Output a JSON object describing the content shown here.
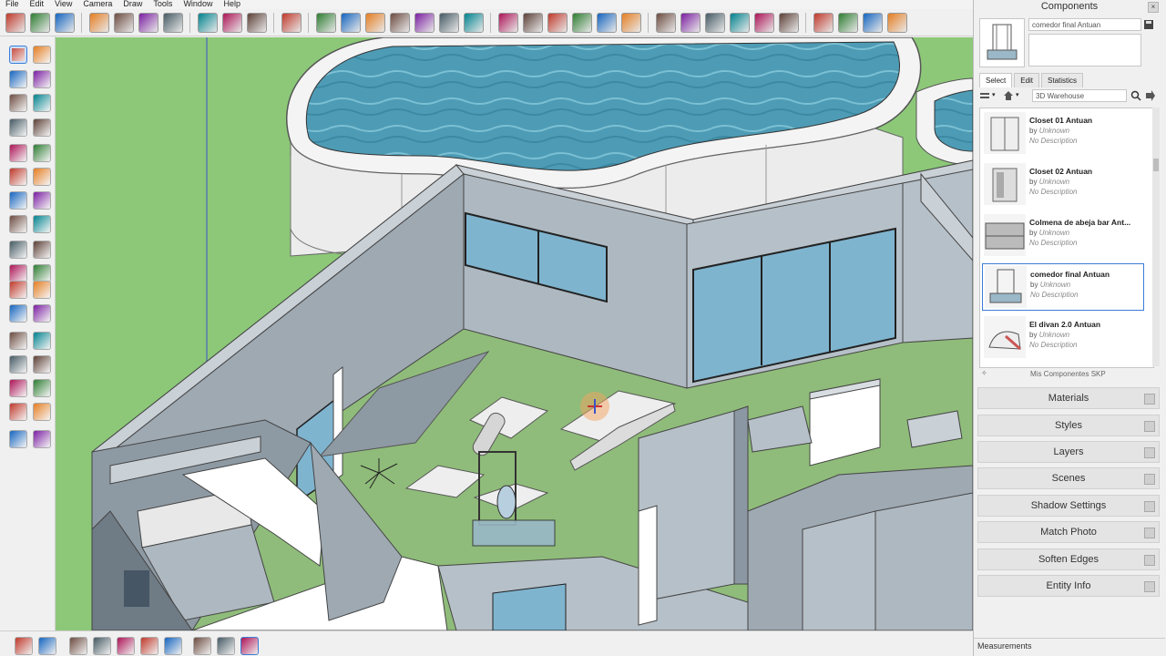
{
  "menu": [
    "File",
    "Edit",
    "View",
    "Camera",
    "Draw",
    "Tools",
    "Window",
    "Help"
  ],
  "panel": {
    "title": "Components",
    "close_glyph": "×",
    "selected_name": "comedor final Antuan",
    "tabs": [
      "Select",
      "Edit",
      "Statistics"
    ],
    "search_value": "3D Warehouse",
    "items": [
      {
        "name": "Closet 01 Antuan",
        "by": "by",
        "author": "Unknown",
        "desc": "No Description",
        "selected": false
      },
      {
        "name": "Closet 02 Antuan",
        "by": "by",
        "author": "Unknown",
        "desc": "No Description",
        "selected": false
      },
      {
        "name": "Colmena de abeja bar Ant...",
        "by": "by",
        "author": "Unknown",
        "desc": "No Description",
        "selected": false
      },
      {
        "name": "comedor final Antuan",
        "by": "by",
        "author": "Unknown",
        "desc": "No Description",
        "selected": true
      },
      {
        "name": "El divan 2.0 Antuan",
        "by": "by",
        "author": "Unknown",
        "desc": "No Description",
        "selected": false
      }
    ],
    "collection": "Mis Componentes SKP",
    "trays": [
      "Materials",
      "Styles",
      "Layers",
      "Scenes",
      "Shadow Settings",
      "Match Photo",
      "Soften Edges",
      "Entity Info"
    ],
    "measurements_label": "Measurements"
  },
  "colors": {
    "grass": "#8cc878",
    "floor": "#8fbc7a",
    "wall": "#a9b4bd",
    "wall_dark": "#8b98a3",
    "water": "#4e9bb5",
    "glass": "#7fb4cf",
    "selection": "#3b7dd8"
  },
  "icons": {
    "toolbar": [
      "get-models-icon",
      "open-icon",
      "save-icon",
      "cut-icon",
      "copy-icon",
      "paste-icon",
      "erase-icon",
      "undo-icon",
      "redo-icon",
      "print-icon",
      "model-info-icon",
      "camera-icon",
      "orbit-icon",
      "pan-icon",
      "zoom-icon",
      "walk-icon",
      "section-icon",
      "house-icon",
      "iso-view-icon",
      "top-view-icon",
      "front-view-icon",
      "right-view-icon",
      "back-view-icon",
      "left-view-icon",
      "xray-icon",
      "wireframe-icon",
      "hidden-line-icon",
      "shaded-icon",
      "textured-icon",
      "monochrome-icon",
      "warehouse-icon",
      "share-icon",
      "extension-icon",
      "ruby-icon"
    ]
  }
}
